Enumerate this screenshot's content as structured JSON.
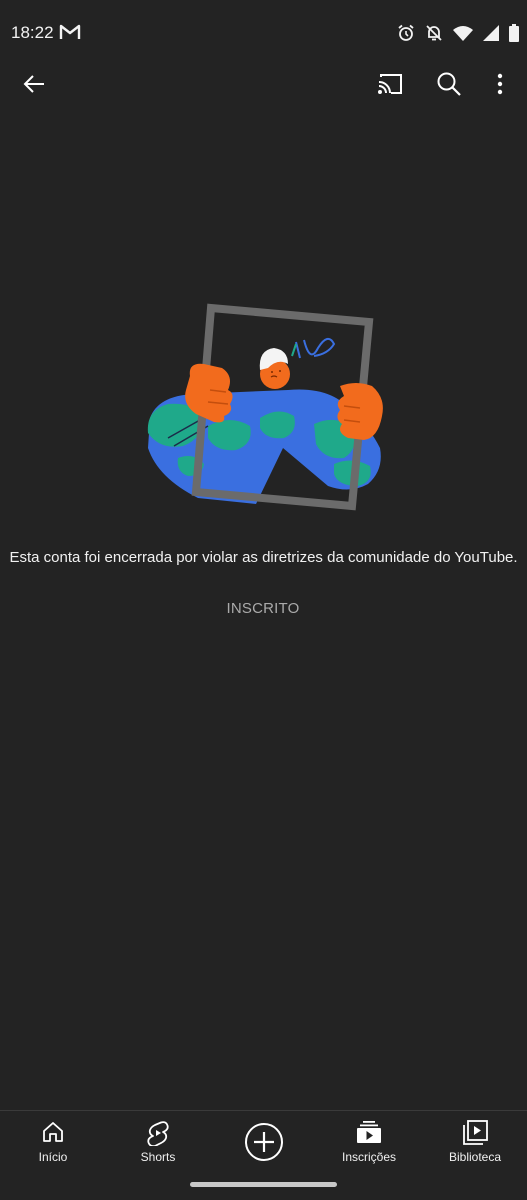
{
  "status_bar": {
    "time": "18:22",
    "icons": [
      "gmail-icon",
      "alarm-icon",
      "notifications-off-icon",
      "wifi-icon",
      "signal-icon",
      "battery-icon"
    ]
  },
  "app_bar": {
    "icons": [
      "back-arrow-icon",
      "cast-icon",
      "search-icon",
      "more-vert-icon"
    ]
  },
  "main": {
    "message": "Esta conta foi encerrada por violar as diretrizes da comunidade do YouTube.",
    "subscribed_label": "INSCRITO"
  },
  "bottom_nav": {
    "items": [
      {
        "label": "Início",
        "icon": "home-icon"
      },
      {
        "label": "Shorts",
        "icon": "shorts-icon"
      },
      {
        "label": "",
        "icon": "create-icon"
      },
      {
        "label": "Inscrições",
        "icon": "subscriptions-icon"
      },
      {
        "label": "Biblioteca",
        "icon": "library-icon"
      }
    ]
  },
  "colors": {
    "background": "#232323",
    "text": "#f1f1f1",
    "muted_text": "#aaaaaa",
    "illustration_blue": "#3a6fe0",
    "illustration_green": "#1fa98a",
    "illustration_orange": "#f26b1d"
  }
}
